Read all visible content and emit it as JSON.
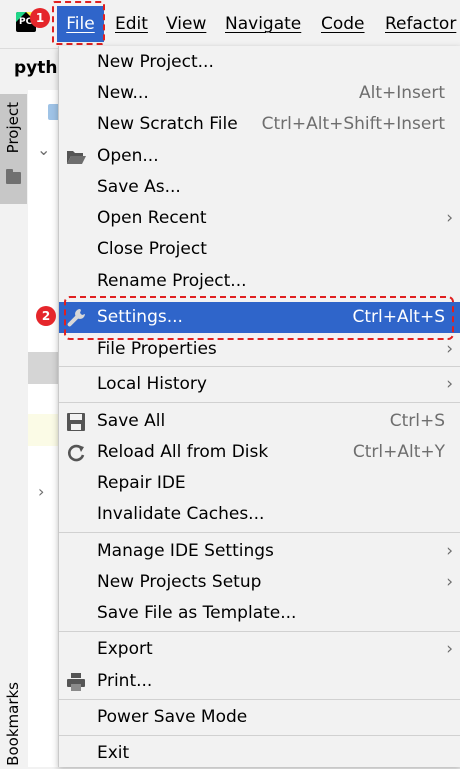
{
  "menubar": {
    "logo_text": "PC",
    "items": [
      "File",
      "Edit",
      "View",
      "Navigate",
      "Code",
      "Refactor"
    ]
  },
  "badges": {
    "one": "1",
    "two": "2"
  },
  "ide": {
    "project_name": "pytho",
    "project_tab": "Project",
    "bookmarks_tab": "Bookmarks"
  },
  "menu": {
    "new_project": "New Project...",
    "new": "New...",
    "new_shortcut": "Alt+Insert",
    "new_scratch": "New Scratch File",
    "new_scratch_shortcut": "Ctrl+Alt+Shift+Insert",
    "open": "Open...",
    "save_as": "Save As...",
    "open_recent": "Open Recent",
    "close_project": "Close Project",
    "rename_project": "Rename Project...",
    "settings": "Settings...",
    "settings_shortcut": "Ctrl+Alt+S",
    "file_properties": "File Properties",
    "local_history": "Local History",
    "save_all": "Save All",
    "save_all_shortcut": "Ctrl+S",
    "reload": "Reload All from Disk",
    "reload_shortcut": "Ctrl+Alt+Y",
    "repair_ide": "Repair IDE",
    "invalidate_caches": "Invalidate Caches...",
    "manage_ide_settings": "Manage IDE Settings",
    "new_projects_setup": "New Projects Setup",
    "save_file_as_template": "Save File as Template...",
    "export": "Export",
    "print": "Print...",
    "power_save": "Power Save Mode",
    "exit": "Exit"
  },
  "colors": {
    "accent": "#2f65ca",
    "highlight_border": "#e02020",
    "badge": "#e5262b"
  }
}
